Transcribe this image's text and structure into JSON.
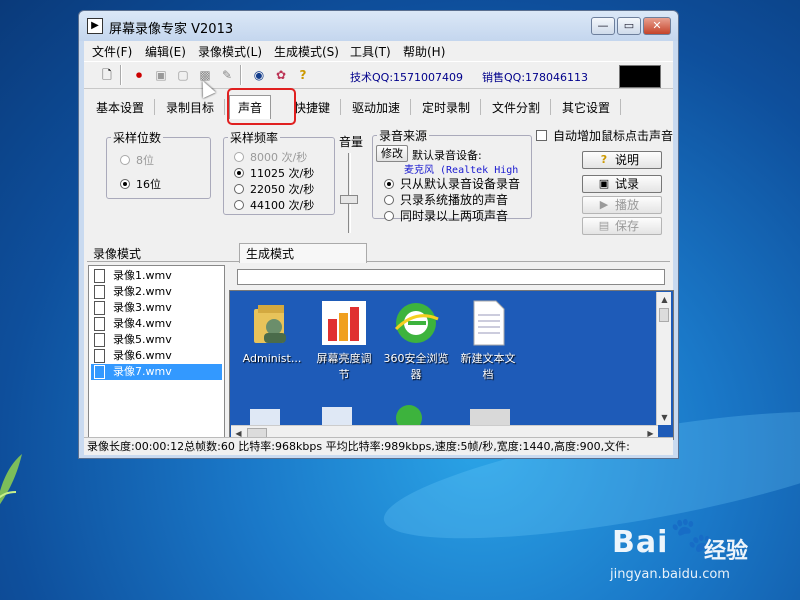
{
  "window": {
    "title": "屏幕录像专家 V2013",
    "controls": {
      "minimize": "—",
      "maximize": "▭",
      "close": "✕"
    }
  },
  "menu": [
    "文件(F)",
    "编辑(E)",
    "录像模式(L)",
    "生成模式(S)",
    "工具(T)",
    "帮助(H)"
  ],
  "toolbar": {
    "tech_qq": "技术QQ:1571007409",
    "sales_qq": "销售QQ:178046113"
  },
  "tabs": [
    "基本设置",
    "录制目标",
    "声音",
    "快捷键",
    "驱动加速",
    "定时录制",
    "文件分割",
    "其它设置"
  ],
  "active_tab": "声音",
  "sample_bits": {
    "legend": "采样位数",
    "options": [
      {
        "label": "8位",
        "selected": false,
        "disabled": true
      },
      {
        "label": "16位",
        "selected": true,
        "disabled": false
      }
    ]
  },
  "sample_rate": {
    "legend": "采样频率",
    "options": [
      {
        "label": "8000 次/秒",
        "selected": false,
        "disabled": true
      },
      {
        "label": "11025 次/秒",
        "selected": true,
        "disabled": false
      },
      {
        "label": "22050 次/秒",
        "selected": false,
        "disabled": false
      },
      {
        "label": "44100 次/秒",
        "selected": false,
        "disabled": false
      }
    ]
  },
  "volume": {
    "label": "音量",
    "level": 0.4
  },
  "sound_source": {
    "legend": "录音来源",
    "modify_label": "修改",
    "default_device_label": "默认录音设备:",
    "device_name": "麦克风 (Realtek High",
    "options": [
      {
        "label": "只从默认录音设备录音",
        "selected": true
      },
      {
        "label": "只录系统播放的声音",
        "selected": false
      },
      {
        "label": "同时录以上两项声音",
        "selected": false
      }
    ]
  },
  "mouse_sound_checkbox": {
    "label": "自动增加鼠标点击声音",
    "checked": false
  },
  "side_buttons": [
    {
      "label": "说明",
      "icon": "?",
      "disabled": false
    },
    {
      "label": "试录",
      "icon": "▣",
      "disabled": false
    },
    {
      "label": "播放",
      "icon": "▶",
      "disabled": true
    },
    {
      "label": "保存",
      "icon": "▤",
      "disabled": true
    }
  ],
  "recording_mode_label": "录像模式",
  "generate_mode_label": "生成模式",
  "recordings": [
    {
      "name": "录像1.wmv",
      "selected": false
    },
    {
      "name": "录像2.wmv",
      "selected": false
    },
    {
      "name": "录像3.wmv",
      "selected": false
    },
    {
      "name": "录像4.wmv",
      "selected": false
    },
    {
      "name": "录像5.wmv",
      "selected": false
    },
    {
      "name": "录像6.wmv",
      "selected": false
    },
    {
      "name": "录像7.wmv",
      "selected": true
    }
  ],
  "preview_icons": [
    {
      "label_line1": "Administ...",
      "label_line2": "",
      "icon": "user-folder"
    },
    {
      "label_line1": "屏幕亮度调",
      "label_line2": "节",
      "icon": "brightness"
    },
    {
      "label_line1": "360安全浏览",
      "label_line2": "器",
      "icon": "browser-360"
    },
    {
      "label_line1": "新建文本文",
      "label_line2": "档",
      "icon": "text-file"
    }
  ],
  "status_bar": "录像长度:00:00:12总帧数:60 比特率:968kbps 平均比特率:989kbps,速度:5帧/秒,宽度:1440,高度:900,文件:",
  "watermark": {
    "brand": "Bai",
    "brand_sub": "经验",
    "url": "jingyan.baidu.com"
  }
}
